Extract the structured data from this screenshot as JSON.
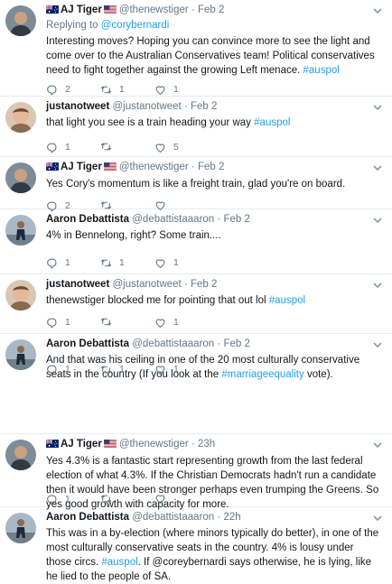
{
  "tweets": [
    {
      "name": "AJ Tiger",
      "handle": "@thenewstiger",
      "time": "Feb 2",
      "replying_prefix": "Replying to",
      "replying_to": "@corybernardi",
      "text_before": "Interesting moves? Hoping you can convince more to see the light and come over to the Australian Conservatives team! Political conservatives need to fight together against the growing Left menace.",
      "hashtag": "#auspol",
      "text_after": "",
      "replies": "2",
      "retweets": "1",
      "likes": "1",
      "avatar": "aj-tiger-avatar"
    },
    {
      "name": "justanotweet",
      "handle": "@justanotweet",
      "time": "Feb 2",
      "text_before": "that light you see is a train heading your way",
      "hashtag": "#auspol",
      "text_after": "",
      "replies": "1",
      "retweets": "",
      "likes": "5",
      "avatar": "justanotweet-avatar"
    },
    {
      "name": "AJ Tiger",
      "handle": "@thenewstiger",
      "time": "Feb 2",
      "text_before": "Yes Cory's momentum is like a freight train, glad you're on board.",
      "hashtag": "",
      "text_after": "",
      "replies": "2",
      "retweets": "",
      "likes": "",
      "avatar": "aj-tiger-avatar"
    },
    {
      "name": "Aaron Debattista",
      "handle": "@debattistaaaron",
      "time": "Feb 2",
      "text_before": "4% in Bennelong, right?  Some train....",
      "hashtag": "",
      "text_after": "",
      "replies": "1",
      "retweets": "1",
      "likes": "1",
      "avatar": "aaron-avatar"
    },
    {
      "name": "justanotweet",
      "handle": "@justanotweet",
      "time": "Feb 2",
      "text_before": "thenewstiger blocked me for pointing that out lol",
      "hashtag": "#auspol",
      "text_after": "",
      "replies": "1",
      "retweets": "",
      "likes": "1",
      "avatar": "justanotweet-avatar"
    },
    {
      "name": "Aaron Debattista",
      "handle": "@debattistaaaron",
      "time": "Feb 2",
      "text_before": "And that was his ceiling in one of the 20 most culturally conservative seats in the country (If you look at the",
      "hashtag": "#marriageequality",
      "text_after": "vote).",
      "replies": "1",
      "retweets": "1",
      "likes": "1",
      "avatar": "aaron-avatar"
    },
    {
      "name": "AJ Tiger",
      "handle": "@thenewstiger",
      "time": "23h",
      "text_before": "Yes 4.3% is a fantastic start representing growth from the last federal election of what 4.3%. If the Christian Democrats hadn't  run a candidate then it would have been stronger perhaps even trumping the Greens. So yes good growth with capacity for more.",
      "hashtag": "",
      "text_after": "",
      "replies": "1",
      "retweets": "",
      "likes": "",
      "avatar": "aj-tiger-avatar"
    },
    {
      "name": "Aaron Debattista",
      "handle": "@debattistaaaron",
      "time": "22h",
      "text_before": "This was in a by-election (where minors typically do better), in one of the most culturally conservative seats in the country. 4% is lousy under those circs.",
      "hashtag": "#auspol",
      "text_after": ". If @coreybernardi says otherwise, he is lying, like he lied to the people of SA.",
      "replies": "",
      "retweets": "",
      "likes": "",
      "avatar": "aaron-avatar"
    }
  ],
  "separator": "·",
  "colors": {
    "link": "#1da1f2",
    "muted": "#657786",
    "text": "#14171a",
    "divider": "#e6ecf0"
  }
}
